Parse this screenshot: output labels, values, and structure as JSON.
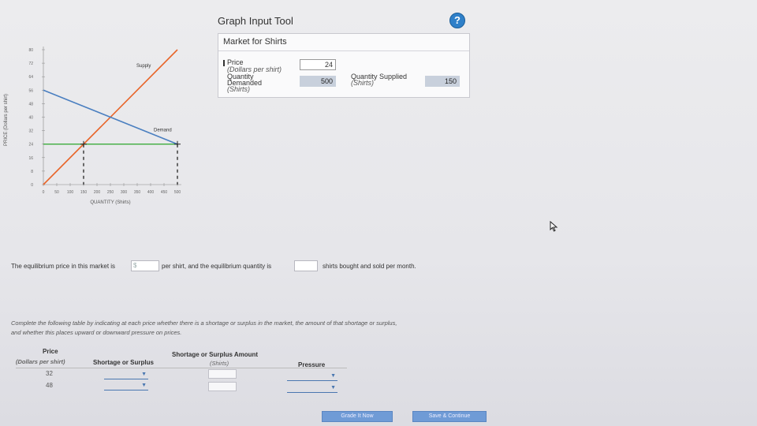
{
  "tool": {
    "title": "Graph Input Tool",
    "help_symbol": "?",
    "market_title": "Market for Shirts",
    "price_label": "Price",
    "price_units": "(Dollars per shirt)",
    "price_value": "24",
    "qd_label_1": "Quantity",
    "qd_label_2": "Demanded",
    "qd_units": "(Shirts)",
    "qd_value": "500",
    "qs_label": "Quantity Supplied",
    "qs_units": "(Shirts)",
    "qs_value": "150"
  },
  "chart_data": {
    "type": "line",
    "xlabel": "QUANTITY (Shirts)",
    "ylabel": "PRICE (Dollars per shirt)",
    "xlim": [
      0,
      500
    ],
    "ylim": [
      0,
      80
    ],
    "x_ticks": [
      0,
      50,
      100,
      150,
      200,
      250,
      300,
      350,
      400,
      450,
      500
    ],
    "y_ticks": [
      0,
      8,
      16,
      24,
      32,
      40,
      48,
      56,
      64,
      72,
      80
    ],
    "series": [
      {
        "name": "Supply",
        "color": "#e8652a",
        "points": [
          [
            0,
            0
          ],
          [
            500,
            80
          ]
        ]
      },
      {
        "name": "Demand",
        "color": "#4a7fc0",
        "points": [
          [
            0,
            56
          ],
          [
            500,
            24
          ]
        ]
      }
    ],
    "price_line": {
      "y": 24,
      "color": "#3cab3c"
    },
    "markers": [
      [
        150,
        24
      ],
      [
        500,
        24
      ]
    ]
  },
  "sentence": {
    "part1": "The equilibrium price in this market is",
    "price_prefix": "$",
    "part2": "per shirt, and the equilibrium quantity is",
    "part3": "shirts bought and sold per month."
  },
  "instructions": {
    "line1": "Complete the following table by indicating at each price whether there is a shortage or surplus in the market, the amount of that shortage or surplus,",
    "line2": "and whether this places upward or downward pressure on prices."
  },
  "table": {
    "col_price": "Price",
    "col_price_units": "(Dollars per shirt)",
    "col_shortage": "Shortage or Surplus",
    "col_amount": "Shortage or Surplus Amount",
    "col_amount_units": "(Shirts)",
    "col_pressure": "Pressure",
    "rows": [
      {
        "price": "32"
      },
      {
        "price": "48"
      }
    ]
  },
  "buttons": {
    "grade": "Grade It Now",
    "save": "Save & Continue"
  }
}
